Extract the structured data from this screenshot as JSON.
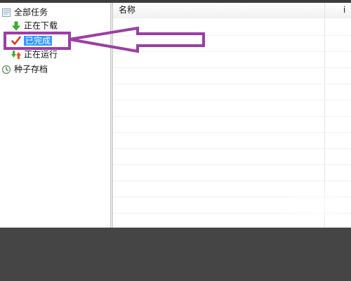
{
  "sidebar": {
    "items": [
      {
        "label": "全部任务",
        "icon": "all-tasks-icon"
      },
      {
        "label": "正在下载",
        "icon": "download-arrow-icon"
      },
      {
        "label": "已完成",
        "icon": "checkmark-icon",
        "selected": true
      },
      {
        "label": "正在运行",
        "icon": "running-arrows-icon"
      },
      {
        "label": "种子存档",
        "icon": "seed-archive-icon"
      }
    ]
  },
  "list": {
    "columns": [
      "名称",
      "i"
    ]
  },
  "colors": {
    "selection": "#3399ff",
    "annotation": "#9b3fa4",
    "download_arrow": "#35b826",
    "check": "#e0351e"
  }
}
